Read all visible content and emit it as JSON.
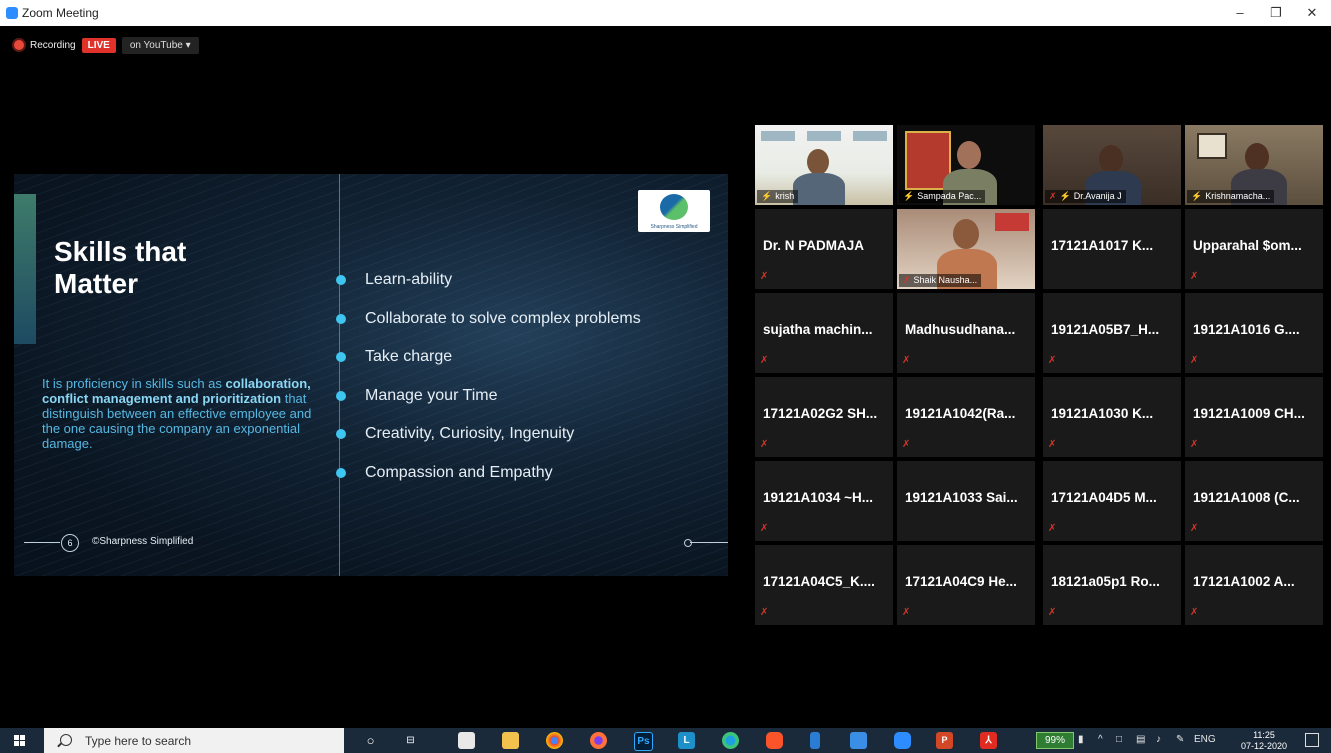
{
  "window": {
    "title": "Zoom Meeting",
    "minimize": "–",
    "maximize": "❐",
    "close": "✕"
  },
  "recording": {
    "label": "Recording",
    "live": "LIVE",
    "stream": "on YouTube ▾"
  },
  "slide": {
    "title_line1": "Skills that",
    "title_line2": "Matter",
    "description_plain1": "It is proficiency in skills such as",
    "description_bold": "collaboration, conflict management and prioritization",
    "description_plain2": "that distinguish between an effective employee and the one causing the company an exponential damage.",
    "bullets": [
      "Learn-ability",
      "Collaborate to solve complex problems",
      "Take charge",
      "Manage your Time",
      "Creativity, Curiosity, Ingenuity",
      "Compassion and Empathy"
    ],
    "page_number": "6",
    "footer": "©Sharpness Simplified",
    "logo_text": "Sharpness Simplified"
  },
  "participants": {
    "video": [
      {
        "label": "krish"
      },
      {
        "label": "Sampada Pac..."
      },
      {
        "label": "Dr.Avanija J"
      },
      {
        "label": "Krishnamacha..."
      },
      {
        "label": "Shaik Nausha..."
      }
    ],
    "names": [
      "Dr. N PADMAJA",
      "17121A1017 K...",
      "Upparahal $om...",
      "sujatha machin...",
      "Madhusudhana...",
      "19121A05B7_H...",
      "19121A1016 G....",
      "17121A02G2 SH...",
      "19121A1042(Ra...",
      "19121A1030 K...",
      "19121A1009 CH...",
      "19121A1034 ~H...",
      "19121A1033 Sai...",
      "17121A04D5 M...",
      "19121A1008 (C...",
      "17121A04C5_K....",
      "17121A04C9 He...",
      "18121a05p1 Ro...",
      "17121A1002 A..."
    ]
  },
  "taskbar": {
    "search_placeholder": "Type here to search",
    "battery": "99%",
    "language": "ENG",
    "time": "11:25",
    "date": "07-12-2020"
  }
}
